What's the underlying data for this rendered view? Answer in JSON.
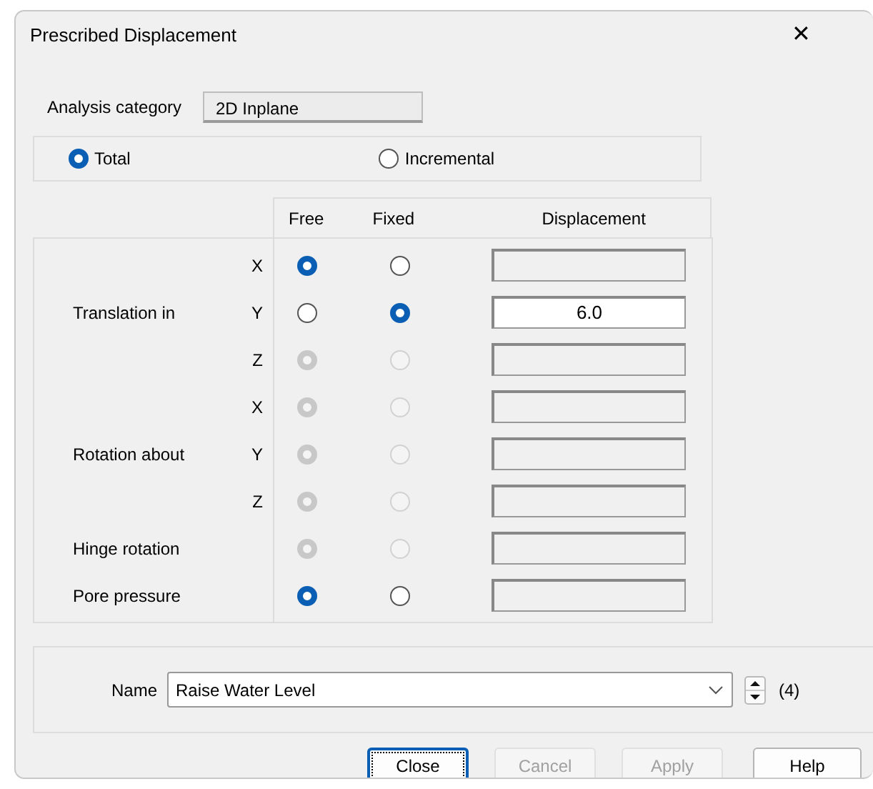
{
  "window": {
    "title": "Prescribed Displacement",
    "close_icon": "✕"
  },
  "analysis_category": {
    "label": "Analysis category",
    "value": "2D Inplane"
  },
  "mode": [
    {
      "label": "Total",
      "selected": true
    },
    {
      "label": "Incremental",
      "selected": false
    }
  ],
  "columns": [
    "Free",
    "Fixed",
    "Displacement"
  ],
  "rows": [
    {
      "axis": "X",
      "fixed": false,
      "disabled": false
    },
    {
      "group": "Translation in",
      "axis": "Y",
      "fixed": true,
      "disabled": false,
      "displacement": "6.0"
    },
    {
      "axis": "Z",
      "fixed": false,
      "disabled": true
    },
    {
      "axis": "X",
      "fixed": false,
      "disabled": true
    },
    {
      "group": "Rotation about",
      "axis": "Y",
      "fixed": false,
      "disabled": true
    },
    {
      "axis": "Z",
      "fixed": false,
      "disabled": true
    },
    {
      "group": "Hinge rotation",
      "fixed": false,
      "disabled": true
    },
    {
      "group": "Pore pressure",
      "fixed": false,
      "disabled": false
    }
  ],
  "name": {
    "label": "Name",
    "value": "Raise Water Level",
    "count": "(4)"
  },
  "buttons": [
    {
      "label": "Close",
      "disabled": false,
      "default": true
    },
    {
      "label": "Cancel",
      "disabled": true,
      "default": false
    },
    {
      "label": "Apply",
      "disabled": true,
      "default": false
    },
    {
      "label": "Help",
      "disabled": false,
      "default": false
    }
  ]
}
